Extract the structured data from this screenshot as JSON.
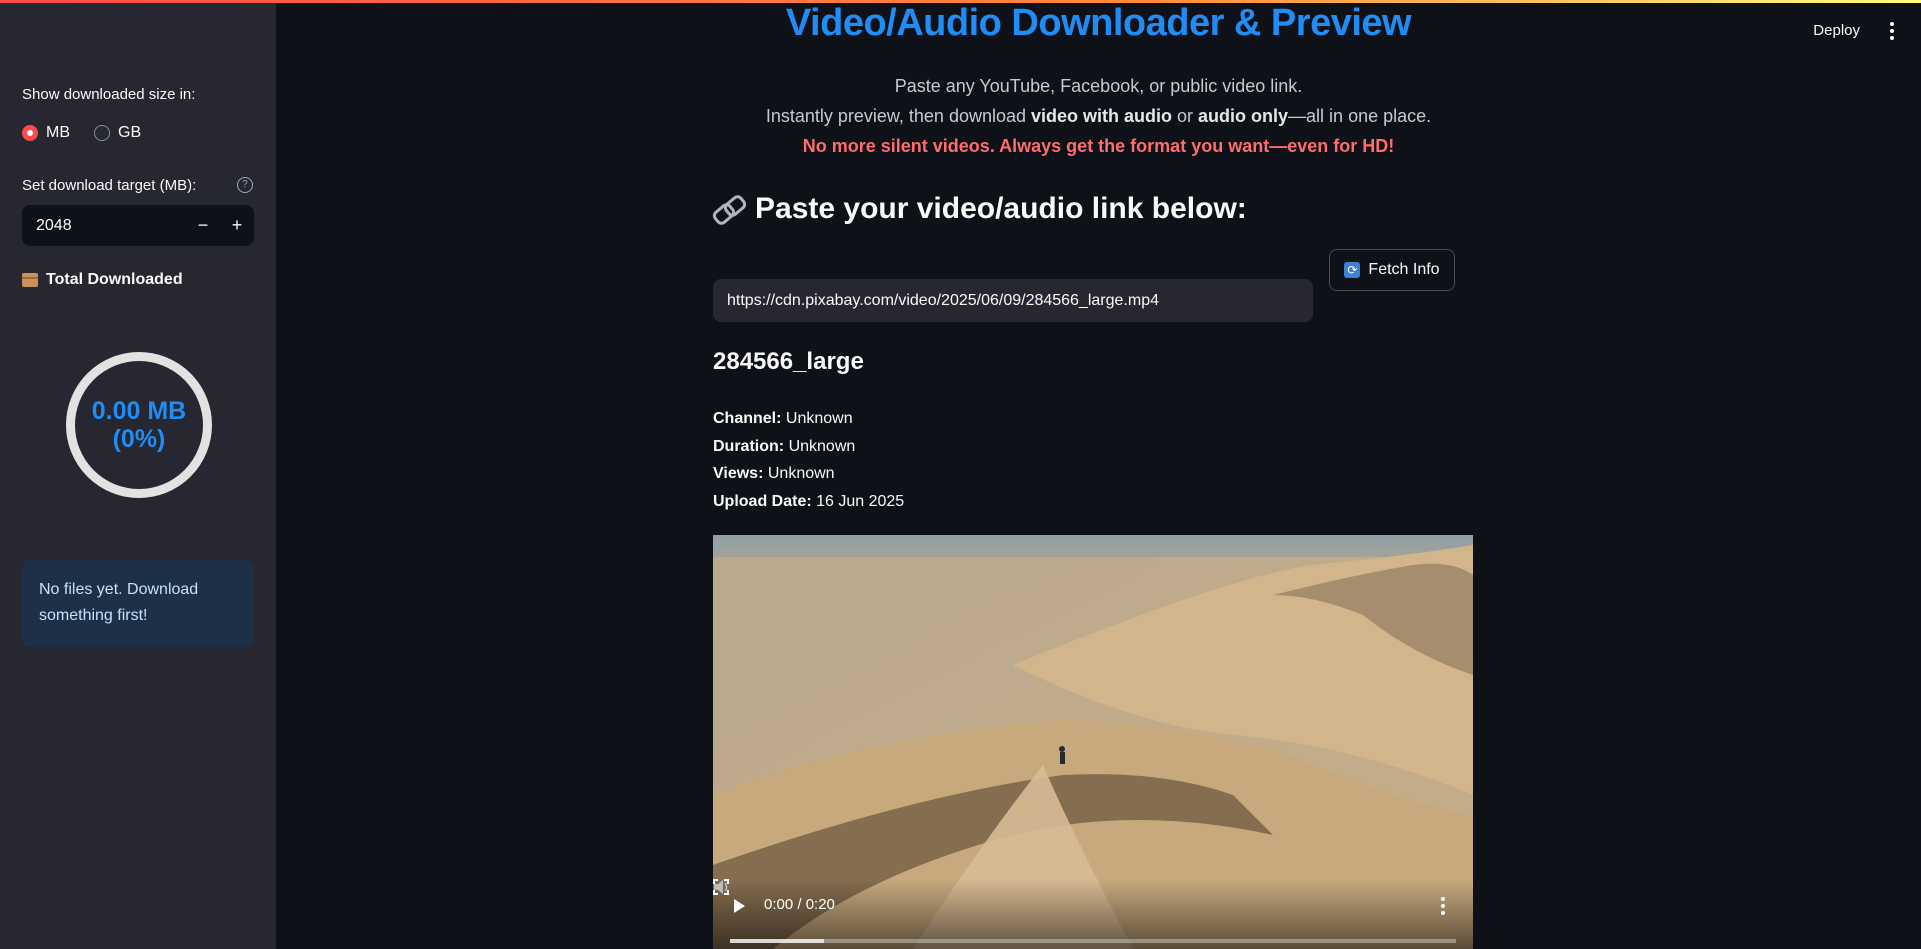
{
  "sidebar": {
    "size_unit_label": "Show downloaded size in:",
    "size_units": [
      "MB",
      "GB"
    ],
    "selected_unit": "MB",
    "target_label": "Set download target (MB):",
    "target_value": "2048",
    "minus": "−",
    "plus": "+",
    "help": "?",
    "total_label": "Total Downloaded",
    "gauge_line1": "0.00 MB",
    "gauge_line2": "(0%)",
    "info_message": "No files yet. Download something first!"
  },
  "header": {
    "deploy_label": "Deploy"
  },
  "main": {
    "title": "Video/Audio Downloader & Preview",
    "subtitle_line1": "Paste any YouTube, Facebook, or public video link.",
    "subtitle_line2": {
      "pre": "Instantly preview, then download ",
      "bold1": "video with audio",
      "mid": " or ",
      "bold2": "audio only",
      "post": "—all in one place."
    },
    "warning": "No more silent videos. Always get the format you want—even for HD!",
    "paste_heading": "Paste your video/audio link below:",
    "fetch_button": "Fetch Info",
    "url_value": "https://cdn.pixabay.com/video/2025/06/09/284566_large.mp4",
    "video_title": "284566_large",
    "meta": [
      {
        "label": "Channel:",
        "value": "Unknown"
      },
      {
        "label": "Duration:",
        "value": "Unknown"
      },
      {
        "label": "Views:",
        "value": "Unknown"
      },
      {
        "label": "Upload Date:",
        "value": "16 Jun 2025"
      }
    ],
    "player": {
      "time": "0:00 / 0:20",
      "buffered_fraction": 0.13
    }
  }
}
